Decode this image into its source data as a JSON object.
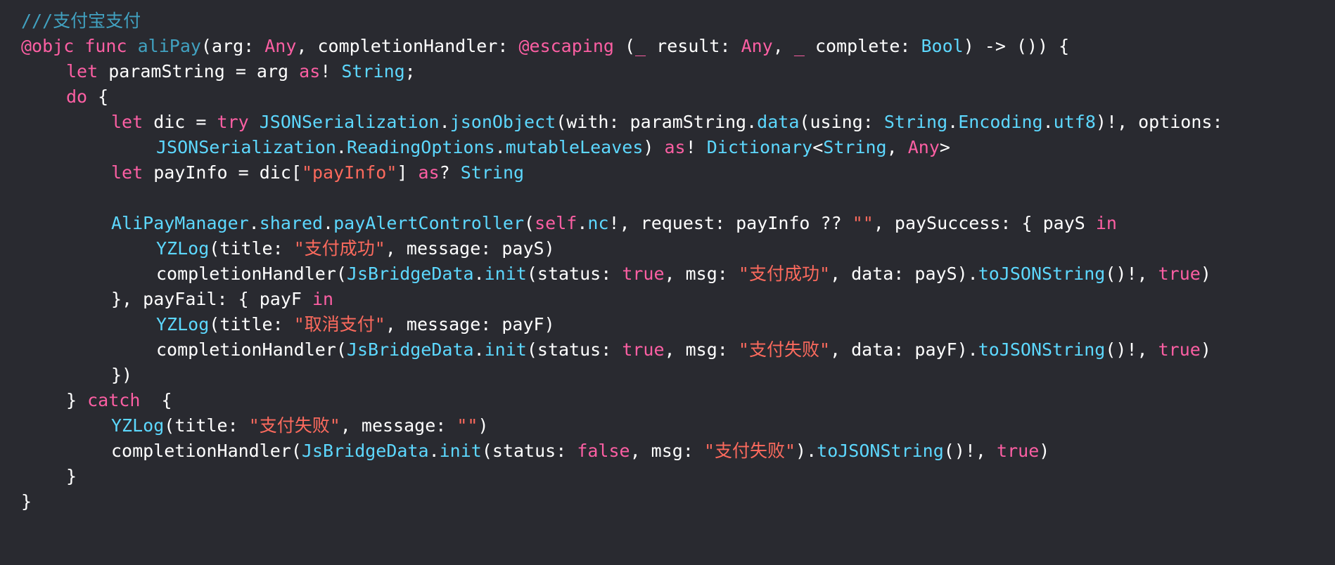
{
  "colors": {
    "background": "#292a30",
    "plain": "#ffffff",
    "comment": "#6c7986",
    "keyword": "#fc5fa3",
    "type": "#41a1c0",
    "string": "#fc6a5d"
  },
  "code": {
    "lines": [
      {
        "indent": 0,
        "tokens": [
          {
            "c": "doc",
            "t": "///"
          },
          {
            "c": "doc-text",
            "t": "支付宝支付"
          }
        ]
      },
      {
        "indent": 0,
        "tokens": [
          {
            "c": "keyword",
            "t": "@objc"
          },
          {
            "c": "plain",
            "t": " "
          },
          {
            "c": "keyword",
            "t": "func"
          },
          {
            "c": "plain",
            "t": " "
          },
          {
            "c": "func",
            "t": "aliPay"
          },
          {
            "c": "plain",
            "t": "(arg: "
          },
          {
            "c": "keyword",
            "t": "Any"
          },
          {
            "c": "plain",
            "t": ", completionHandler: "
          },
          {
            "c": "keyword",
            "t": "@escaping"
          },
          {
            "c": "plain",
            "t": " ("
          },
          {
            "c": "keyword",
            "t": "_"
          },
          {
            "c": "plain",
            "t": " result: "
          },
          {
            "c": "keyword",
            "t": "Any"
          },
          {
            "c": "plain",
            "t": ", "
          },
          {
            "c": "keyword",
            "t": "_"
          },
          {
            "c": "plain",
            "t": " complete: "
          },
          {
            "c": "type",
            "t": "Bool"
          },
          {
            "c": "plain",
            "t": ") -> ()) {"
          }
        ]
      },
      {
        "indent": 1,
        "tokens": [
          {
            "c": "keyword",
            "t": "let"
          },
          {
            "c": "plain",
            "t": " paramString = arg "
          },
          {
            "c": "keyword",
            "t": "as"
          },
          {
            "c": "plain",
            "t": "! "
          },
          {
            "c": "type",
            "t": "String"
          },
          {
            "c": "plain",
            "t": ";"
          }
        ]
      },
      {
        "indent": 1,
        "tokens": [
          {
            "c": "keyword",
            "t": "do"
          },
          {
            "c": "plain",
            "t": " {"
          }
        ]
      },
      {
        "indent": 2,
        "tokens": [
          {
            "c": "keyword",
            "t": "let"
          },
          {
            "c": "plain",
            "t": " dic = "
          },
          {
            "c": "keyword",
            "t": "try"
          },
          {
            "c": "plain",
            "t": " "
          },
          {
            "c": "type",
            "t": "JSONSerialization"
          },
          {
            "c": "plain",
            "t": "."
          },
          {
            "c": "type",
            "t": "jsonObject"
          },
          {
            "c": "plain",
            "t": "(with: paramString."
          },
          {
            "c": "type",
            "t": "data"
          },
          {
            "c": "plain",
            "t": "(using: "
          },
          {
            "c": "type",
            "t": "String"
          },
          {
            "c": "plain",
            "t": "."
          },
          {
            "c": "type",
            "t": "Encoding"
          },
          {
            "c": "plain",
            "t": "."
          },
          {
            "c": "type",
            "t": "utf8"
          },
          {
            "c": "plain",
            "t": ")!, options:"
          }
        ]
      },
      {
        "indent": 3,
        "tokens": [
          {
            "c": "type",
            "t": "JSONSerialization"
          },
          {
            "c": "plain",
            "t": "."
          },
          {
            "c": "type",
            "t": "ReadingOptions"
          },
          {
            "c": "plain",
            "t": "."
          },
          {
            "c": "type",
            "t": "mutableLeaves"
          },
          {
            "c": "plain",
            "t": ") "
          },
          {
            "c": "keyword",
            "t": "as"
          },
          {
            "c": "plain",
            "t": "! "
          },
          {
            "c": "type",
            "t": "Dictionary"
          },
          {
            "c": "plain",
            "t": "<"
          },
          {
            "c": "type",
            "t": "String"
          },
          {
            "c": "plain",
            "t": ", "
          },
          {
            "c": "keyword",
            "t": "Any"
          },
          {
            "c": "plain",
            "t": ">"
          }
        ]
      },
      {
        "indent": 2,
        "tokens": [
          {
            "c": "keyword",
            "t": "let"
          },
          {
            "c": "plain",
            "t": " payInfo = dic["
          },
          {
            "c": "string",
            "t": "\"payInfo\""
          },
          {
            "c": "plain",
            "t": "] "
          },
          {
            "c": "keyword",
            "t": "as"
          },
          {
            "c": "plain",
            "t": "? "
          },
          {
            "c": "type",
            "t": "String"
          }
        ]
      },
      {
        "indent": 0,
        "tokens": []
      },
      {
        "indent": 2,
        "tokens": [
          {
            "c": "type",
            "t": "AliPayManager"
          },
          {
            "c": "plain",
            "t": "."
          },
          {
            "c": "type",
            "t": "shared"
          },
          {
            "c": "plain",
            "t": "."
          },
          {
            "c": "type",
            "t": "payAlertController"
          },
          {
            "c": "plain",
            "t": "("
          },
          {
            "c": "keyword",
            "t": "self"
          },
          {
            "c": "plain",
            "t": "."
          },
          {
            "c": "type",
            "t": "nc"
          },
          {
            "c": "plain",
            "t": "!, request: payInfo ?? "
          },
          {
            "c": "string",
            "t": "\"\""
          },
          {
            "c": "plain",
            "t": ", paySuccess: { payS "
          },
          {
            "c": "keyword",
            "t": "in"
          }
        ]
      },
      {
        "indent": 3,
        "tokens": [
          {
            "c": "type",
            "t": "YZLog"
          },
          {
            "c": "plain",
            "t": "(title: "
          },
          {
            "c": "string",
            "t": "\"支付成功\""
          },
          {
            "c": "plain",
            "t": ", message: payS)"
          }
        ]
      },
      {
        "indent": 3,
        "tokens": [
          {
            "c": "plain",
            "t": "completionHandler("
          },
          {
            "c": "type",
            "t": "JsBridgeData"
          },
          {
            "c": "plain",
            "t": "."
          },
          {
            "c": "type",
            "t": "init"
          },
          {
            "c": "plain",
            "t": "(status: "
          },
          {
            "c": "keyword",
            "t": "true"
          },
          {
            "c": "plain",
            "t": ", msg: "
          },
          {
            "c": "string",
            "t": "\"支付成功\""
          },
          {
            "c": "plain",
            "t": ", data: payS)."
          },
          {
            "c": "type",
            "t": "toJSONString"
          },
          {
            "c": "plain",
            "t": "()!, "
          },
          {
            "c": "keyword",
            "t": "true"
          },
          {
            "c": "plain",
            "t": ")"
          }
        ]
      },
      {
        "indent": 2,
        "tokens": [
          {
            "c": "plain",
            "t": "}, payFail: { payF "
          },
          {
            "c": "keyword",
            "t": "in"
          }
        ]
      },
      {
        "indent": 3,
        "tokens": [
          {
            "c": "type",
            "t": "YZLog"
          },
          {
            "c": "plain",
            "t": "(title: "
          },
          {
            "c": "string",
            "t": "\"取消支付\""
          },
          {
            "c": "plain",
            "t": ", message: payF)"
          }
        ]
      },
      {
        "indent": 3,
        "tokens": [
          {
            "c": "plain",
            "t": "completionHandler("
          },
          {
            "c": "type",
            "t": "JsBridgeData"
          },
          {
            "c": "plain",
            "t": "."
          },
          {
            "c": "type",
            "t": "init"
          },
          {
            "c": "plain",
            "t": "(status: "
          },
          {
            "c": "keyword",
            "t": "true"
          },
          {
            "c": "plain",
            "t": ", msg: "
          },
          {
            "c": "string",
            "t": "\"支付失败\""
          },
          {
            "c": "plain",
            "t": ", data: payF)."
          },
          {
            "c": "type",
            "t": "toJSONString"
          },
          {
            "c": "plain",
            "t": "()!, "
          },
          {
            "c": "keyword",
            "t": "true"
          },
          {
            "c": "plain",
            "t": ")"
          }
        ]
      },
      {
        "indent": 2,
        "tokens": [
          {
            "c": "plain",
            "t": "})"
          }
        ]
      },
      {
        "indent": 1,
        "tokens": [
          {
            "c": "plain",
            "t": "} "
          },
          {
            "c": "keyword",
            "t": "catch"
          },
          {
            "c": "plain",
            "t": "  {"
          }
        ]
      },
      {
        "indent": 2,
        "tokens": [
          {
            "c": "type",
            "t": "YZLog"
          },
          {
            "c": "plain",
            "t": "(title: "
          },
          {
            "c": "string",
            "t": "\"支付失败\""
          },
          {
            "c": "plain",
            "t": ", message: "
          },
          {
            "c": "string",
            "t": "\"\""
          },
          {
            "c": "plain",
            "t": ")"
          }
        ]
      },
      {
        "indent": 2,
        "tokens": [
          {
            "c": "plain",
            "t": "completionHandler("
          },
          {
            "c": "type",
            "t": "JsBridgeData"
          },
          {
            "c": "plain",
            "t": "."
          },
          {
            "c": "type",
            "t": "init"
          },
          {
            "c": "plain",
            "t": "(status: "
          },
          {
            "c": "keyword",
            "t": "false"
          },
          {
            "c": "plain",
            "t": ", msg: "
          },
          {
            "c": "string",
            "t": "\"支付失败\""
          },
          {
            "c": "plain",
            "t": ")."
          },
          {
            "c": "type",
            "t": "toJSONString"
          },
          {
            "c": "plain",
            "t": "()!, "
          },
          {
            "c": "keyword",
            "t": "true"
          },
          {
            "c": "plain",
            "t": ")"
          }
        ]
      },
      {
        "indent": 1,
        "tokens": [
          {
            "c": "plain",
            "t": "}"
          }
        ]
      },
      {
        "indent": 0,
        "tokens": [
          {
            "c": "plain",
            "t": "}"
          }
        ]
      }
    ]
  }
}
